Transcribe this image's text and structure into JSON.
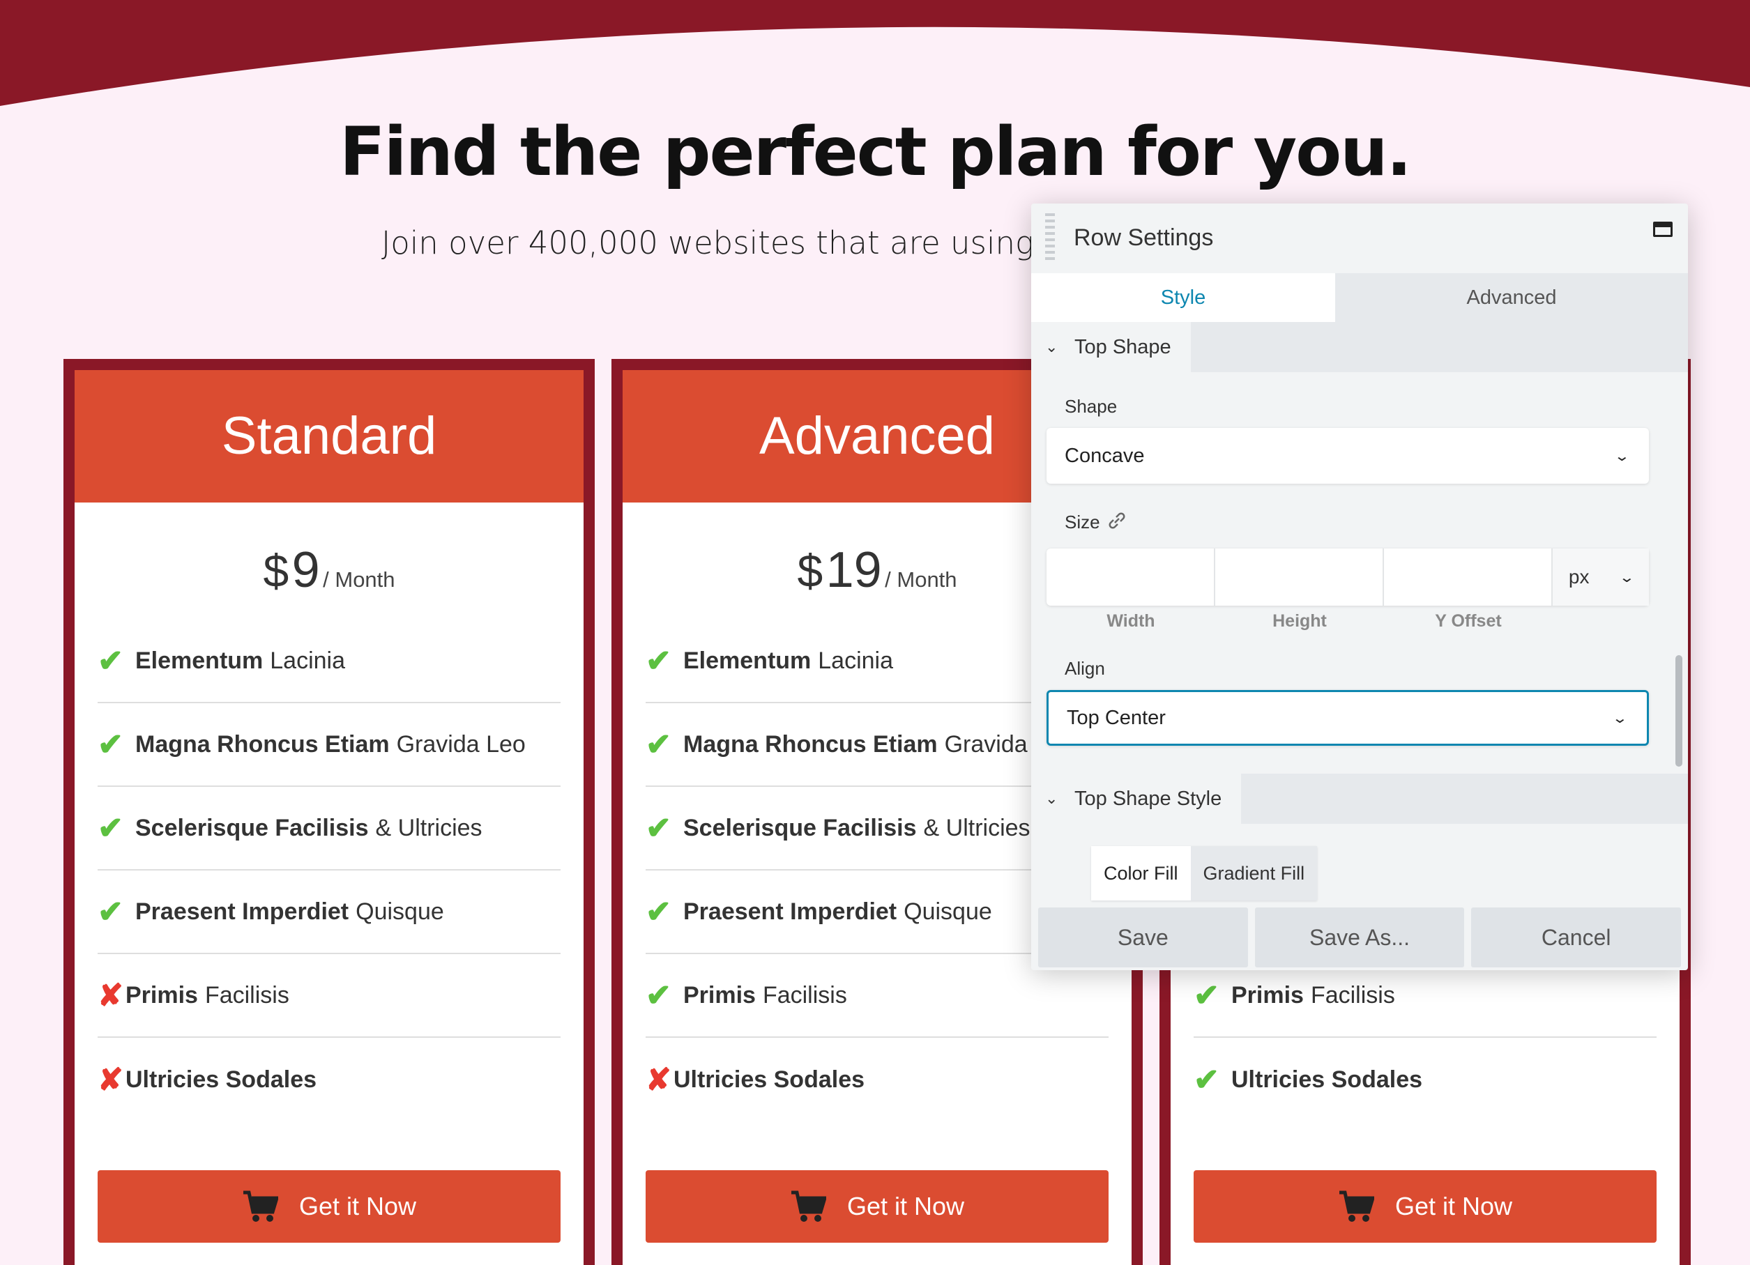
{
  "colors": {
    "maroon": "#8a1827",
    "accent": "#db4c31",
    "check": "#5cc040",
    "cross": "#e8392f",
    "tab_active": "#0e87b0"
  },
  "hero": {
    "title": "Find the perfect plan for you.",
    "subtitle": "Join over 400,000 websites that are using a"
  },
  "plans": [
    {
      "name": "Standard",
      "currency": "$",
      "amount": "9",
      "period": "/ Month",
      "features": [
        {
          "icon": "check-icon",
          "bold": "Elementum",
          "text": "Lacinia"
        },
        {
          "icon": "check-icon",
          "bold": "Magna Rhoncus Etiam",
          "text": "Gravida Leo"
        },
        {
          "icon": "check-icon",
          "bold": "Scelerisque Facilisis",
          "text": "& Ultricies"
        },
        {
          "icon": "check-icon",
          "bold": "Praesent Imperdiet",
          "text": "Quisque"
        },
        {
          "icon": "cross-icon",
          "bold": "Primis",
          "text": "Facilisis"
        },
        {
          "icon": "cross-icon",
          "bold": "Ultricies Sodales",
          "text": ""
        }
      ],
      "button": "Get it Now"
    },
    {
      "name": "Advanced",
      "currency": "$",
      "amount": "19",
      "period": "/ Month",
      "features": [
        {
          "icon": "check-icon",
          "bold": "Elementum",
          "text": "Lacinia"
        },
        {
          "icon": "check-icon",
          "bold": "Magna Rhoncus Etiam",
          "text": "Gravida"
        },
        {
          "icon": "check-icon",
          "bold": "Scelerisque Facilisis",
          "text": "& Ultricies"
        },
        {
          "icon": "check-icon",
          "bold": "Praesent Imperdiet",
          "text": "Quisque"
        },
        {
          "icon": "check-icon",
          "bold": "Primis",
          "text": "Facilisis"
        },
        {
          "icon": "cross-icon",
          "bold": "Ultricies Sodales",
          "text": ""
        }
      ],
      "button": "Get it Now"
    },
    {
      "name": "",
      "currency": "",
      "amount": "",
      "period": "",
      "features": [
        {
          "icon": "check-icon",
          "bold": "",
          "text": ""
        },
        {
          "icon": "check-icon",
          "bold": "",
          "text": ""
        },
        {
          "icon": "check-icon",
          "bold": "",
          "text": ""
        },
        {
          "icon": "check-icon",
          "bold": "",
          "text": ""
        },
        {
          "icon": "check-icon",
          "bold": "Primis",
          "text": "Facilisis"
        },
        {
          "icon": "check-icon",
          "bold": "Ultricies Sodales",
          "text": ""
        }
      ],
      "button": "Get it Now"
    }
  ],
  "panel": {
    "title": "Row Settings",
    "tabs": [
      "Style",
      "Advanced"
    ],
    "section_top_shape": "Top Shape",
    "shape_label": "Shape",
    "shape_value": "Concave",
    "size_label": "Size",
    "size_unit": "px",
    "size_sublabels": [
      "Width",
      "Height",
      "Y Offset"
    ],
    "align_label": "Align",
    "align_value": "Top Center",
    "section_top_shape_style": "Top Shape Style",
    "fill_options": [
      "Color Fill",
      "Gradient Fill"
    ],
    "footer": [
      "Save",
      "Save As...",
      "Cancel"
    ]
  }
}
